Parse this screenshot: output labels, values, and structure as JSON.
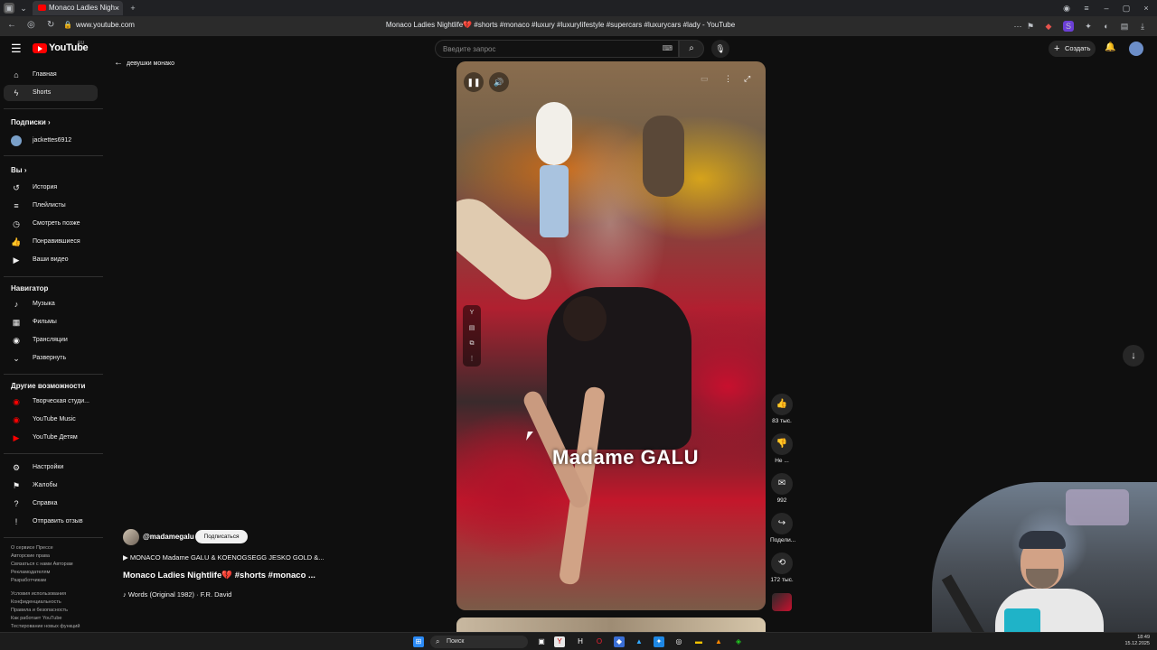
{
  "browser": {
    "tab_title": "Monaco Ladies Nigh",
    "url": "www.youtube.com",
    "page_title": "Monaco Ladies Nightlife💔 #shorts #monaco #luxury #luxurylifestyle #supercars #luxurycars #lady - YouTube"
  },
  "header": {
    "logo_text": "YouTube",
    "region": "RU",
    "search_placeholder": "Введите запрос",
    "create_label": "Создать"
  },
  "sidebar": {
    "main": [
      {
        "label": "Главная",
        "icon": "home-icon"
      },
      {
        "label": "Shorts",
        "icon": "shorts-icon"
      }
    ],
    "subscriptions_heading": "Подписки",
    "subscriptions": [
      {
        "label": "jackettes6912"
      }
    ],
    "you_heading": "Вы",
    "you": [
      {
        "label": "История",
        "icon": "history-icon"
      },
      {
        "label": "Плейлисты",
        "icon": "playlists-icon"
      },
      {
        "label": "Смотреть позже",
        "icon": "watch-later-icon"
      },
      {
        "label": "Понравившиеся",
        "icon": "liked-icon"
      },
      {
        "label": "Ваши видео",
        "icon": "your-videos-icon"
      }
    ],
    "navigator_heading": "Навигатор",
    "navigator": [
      {
        "label": "Музыка",
        "icon": "music-icon"
      },
      {
        "label": "Фильмы",
        "icon": "films-icon"
      },
      {
        "label": "Трансляции",
        "icon": "live-icon"
      },
      {
        "label": "Развернуть",
        "icon": "chevron-down-icon"
      }
    ],
    "more_heading": "Другие возможности",
    "more": [
      {
        "label": "Творческая студи...",
        "icon": "studio-icon"
      },
      {
        "label": "YouTube Music",
        "icon": "yt-music-icon"
      },
      {
        "label": "YouTube Детям",
        "icon": "yt-kids-icon"
      }
    ],
    "settings": [
      {
        "label": "Настройки",
        "icon": "gear-icon"
      },
      {
        "label": "Жалобы",
        "icon": "flag-icon"
      },
      {
        "label": "Справка",
        "icon": "help-icon"
      },
      {
        "label": "Отправить отзыв",
        "icon": "feedback-icon"
      }
    ],
    "footer1": "О сервисе  Прессе\nАвторские права\nСвязаться с нами  Авторам\nРекламодателям\nРазработчикам",
    "footer2": "Условия использования\nКонфиденциальность\nПравила и безопасность\nКак работает YouTube\nТестирование новых функций"
  },
  "back_link": "девушки монако",
  "video": {
    "overlay_text": "Madame GALU",
    "channel": "@madamegalu",
    "subscribe_label": "Подписаться",
    "clip_title": "▶ MONACO Madame GALU & KOENOGSEGG JESKO GOLD &...",
    "title": "Monaco Ladies Nightlife💔 #shorts #monaco ...",
    "music": "♪ Words (Original 1982) · F.R. David"
  },
  "actions": {
    "likes": "83 тыс.",
    "dislike": "Не ...",
    "comments": "992",
    "share": "Подели...",
    "remix": "172 тыс."
  },
  "taskbar": {
    "search_label": "Поиск",
    "time": "18:49",
    "date": "15.12.2025"
  }
}
